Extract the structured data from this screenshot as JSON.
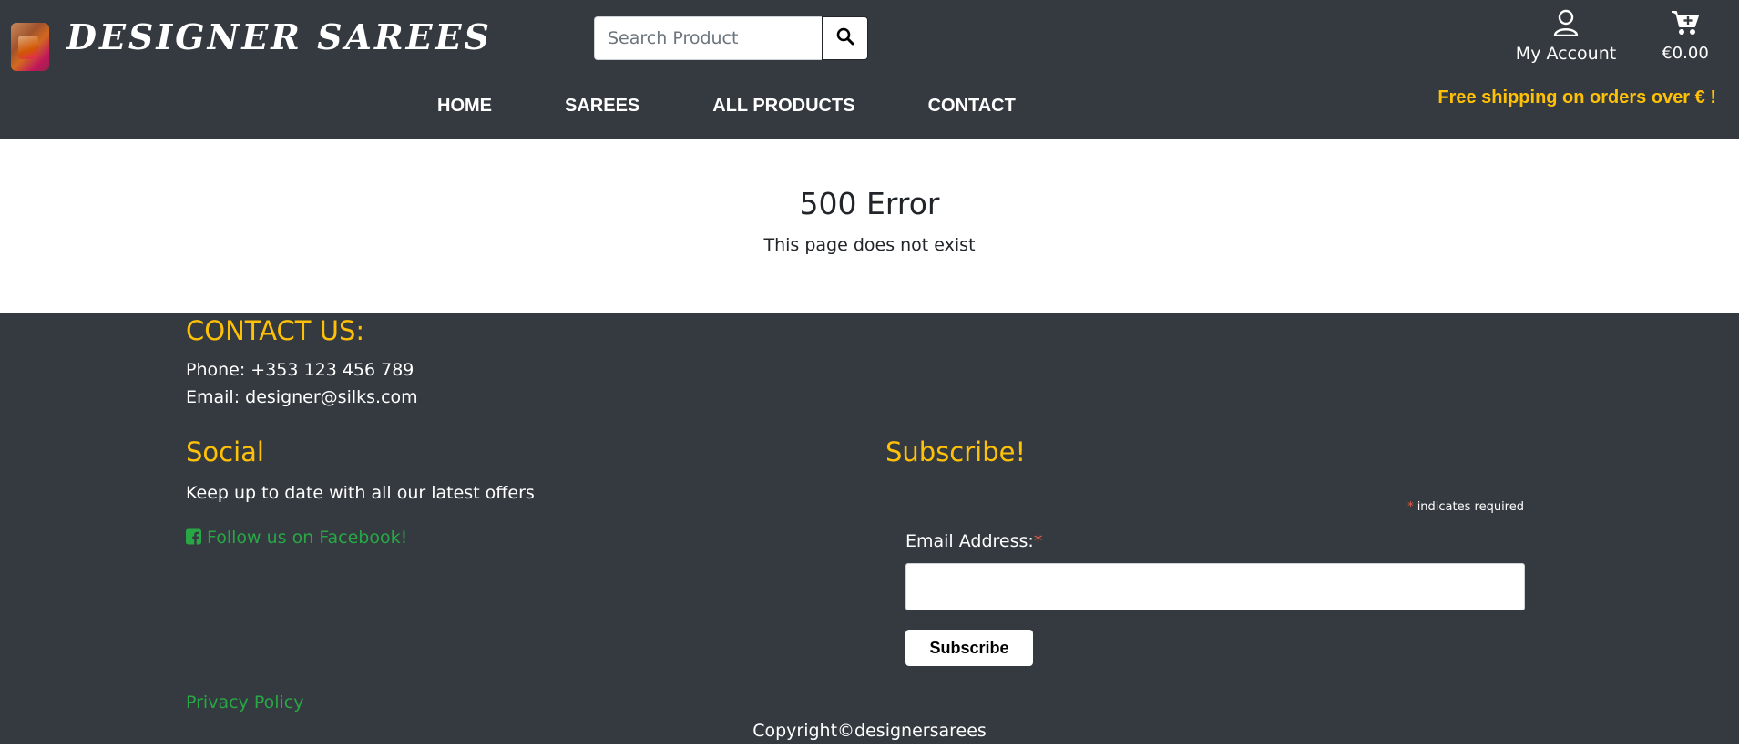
{
  "header": {
    "brand": "DESIGNER SAREES",
    "search": {
      "placeholder": "Search Product"
    },
    "account_label": "My Account",
    "cart_total": "€0.00",
    "shipping_banner": "Free shipping on orders over € !"
  },
  "nav": {
    "items": [
      {
        "label": "HOME"
      },
      {
        "label": "SAREES"
      },
      {
        "label": "ALL PRODUCTS"
      },
      {
        "label": "CONTACT"
      }
    ]
  },
  "main": {
    "title": "500 Error",
    "message": "This page does not exist"
  },
  "footer": {
    "contact_heading": "CONTACT US:",
    "phone": "Phone: +353 123 456 789",
    "email": "Email: designer@silks.com",
    "social_heading": "Social",
    "social_text": "Keep up to date with all our latest offers",
    "facebook_link": "Follow us on Facebook!",
    "privacy_link": "Privacy Policy",
    "subscribe_heading": "Subscribe!",
    "required_asterisk": "*",
    "required_note": " indicates required",
    "email_label": "Email Address:",
    "subscribe_button": "Subscribe",
    "copyright": "Copyright©designersarees"
  },
  "colors": {
    "header_bg": "#343a40",
    "accent_yellow": "#ffc107",
    "link_green": "#28a745",
    "required_red": "#e85c41"
  },
  "icons": [
    "search-icon",
    "user-icon",
    "cart-plus-icon",
    "facebook-square-icon"
  ]
}
